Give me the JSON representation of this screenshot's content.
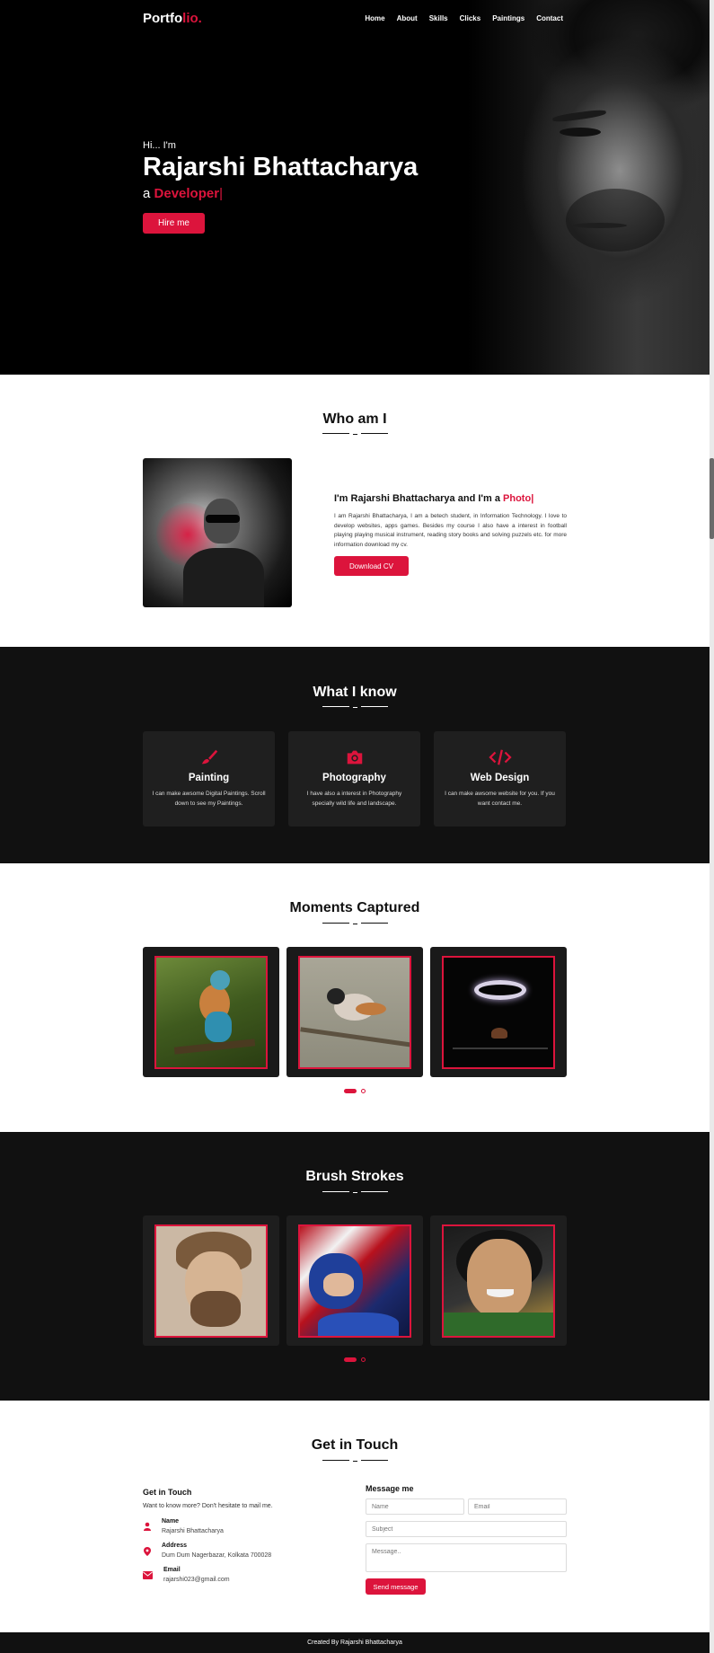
{
  "nav": {
    "logo_main": "Portfo",
    "logo_accent": "lio.",
    "items": [
      {
        "label": "Home"
      },
      {
        "label": "About"
      },
      {
        "label": "Skills"
      },
      {
        "label": "Clicks"
      },
      {
        "label": "Paintings"
      },
      {
        "label": "Contact"
      }
    ]
  },
  "hero": {
    "greeting": "Hi... I'm",
    "name": "Rajarshi Bhattacharya",
    "role_prefix": "a",
    "role_typed": "Developer",
    "cursor": "|",
    "cta": "Hire me"
  },
  "about": {
    "title": "Who am I",
    "heading_prefix": "I'm Rajarshi Bhattacharya and I'm a",
    "heading_typed": "Photo|",
    "body": "I am Rajarshi Bhattacharya, I am a betech student, in Information Technology. I love to develop websites, apps games. Besides my course I also have a interest in football playing playing musical instrument, reading story books and solving puzzels etc. for more information download my cv.",
    "cta": "Download CV"
  },
  "skills": {
    "title": "What I know",
    "cards": [
      {
        "icon": "paintbrush-icon",
        "name": "Painting",
        "desc": "I can make awsome Digital Paintings. Scroll down to see my Paintings."
      },
      {
        "icon": "camera-icon",
        "name": "Photography",
        "desc": "I have also a interest in Photography specially wild life and landscape."
      },
      {
        "icon": "code-icon",
        "name": "Web Design",
        "desc": "I can make awsome website for you. If you want contact me."
      }
    ]
  },
  "moments": {
    "title": "Moments Captured",
    "images": [
      "kingfisher-bird-photo",
      "small-bird-on-branch-photo",
      "ring-of-light-photo"
    ]
  },
  "brush": {
    "title": "Brush Strokes",
    "images": [
      "bearded-man-portrait-painting",
      "captain-america-painting",
      "smiling-woman-portrait-painting"
    ]
  },
  "contact": {
    "title": "Get in Touch",
    "left_title": "Get in Touch",
    "left_sub": "Want to know more? Don't hesitate to mail me.",
    "name_label": "Name",
    "name_value": "Rajarshi Bhattacharya",
    "address_label": "Address",
    "address_value": "Dum Dum Nagerbazar, Kolkata 700028",
    "email_label": "Email",
    "email_value": "rajarshi023@gmail.com",
    "form_title": "Message me",
    "ph_name": "Name",
    "ph_email": "Email",
    "ph_subject": "Subject",
    "ph_message": "Message..",
    "send": "Send message"
  },
  "footer": {
    "text": "Created By Rajarshi Bhattacharya"
  },
  "colors": {
    "accent": "#dc143c",
    "dark_section": "#111111"
  }
}
